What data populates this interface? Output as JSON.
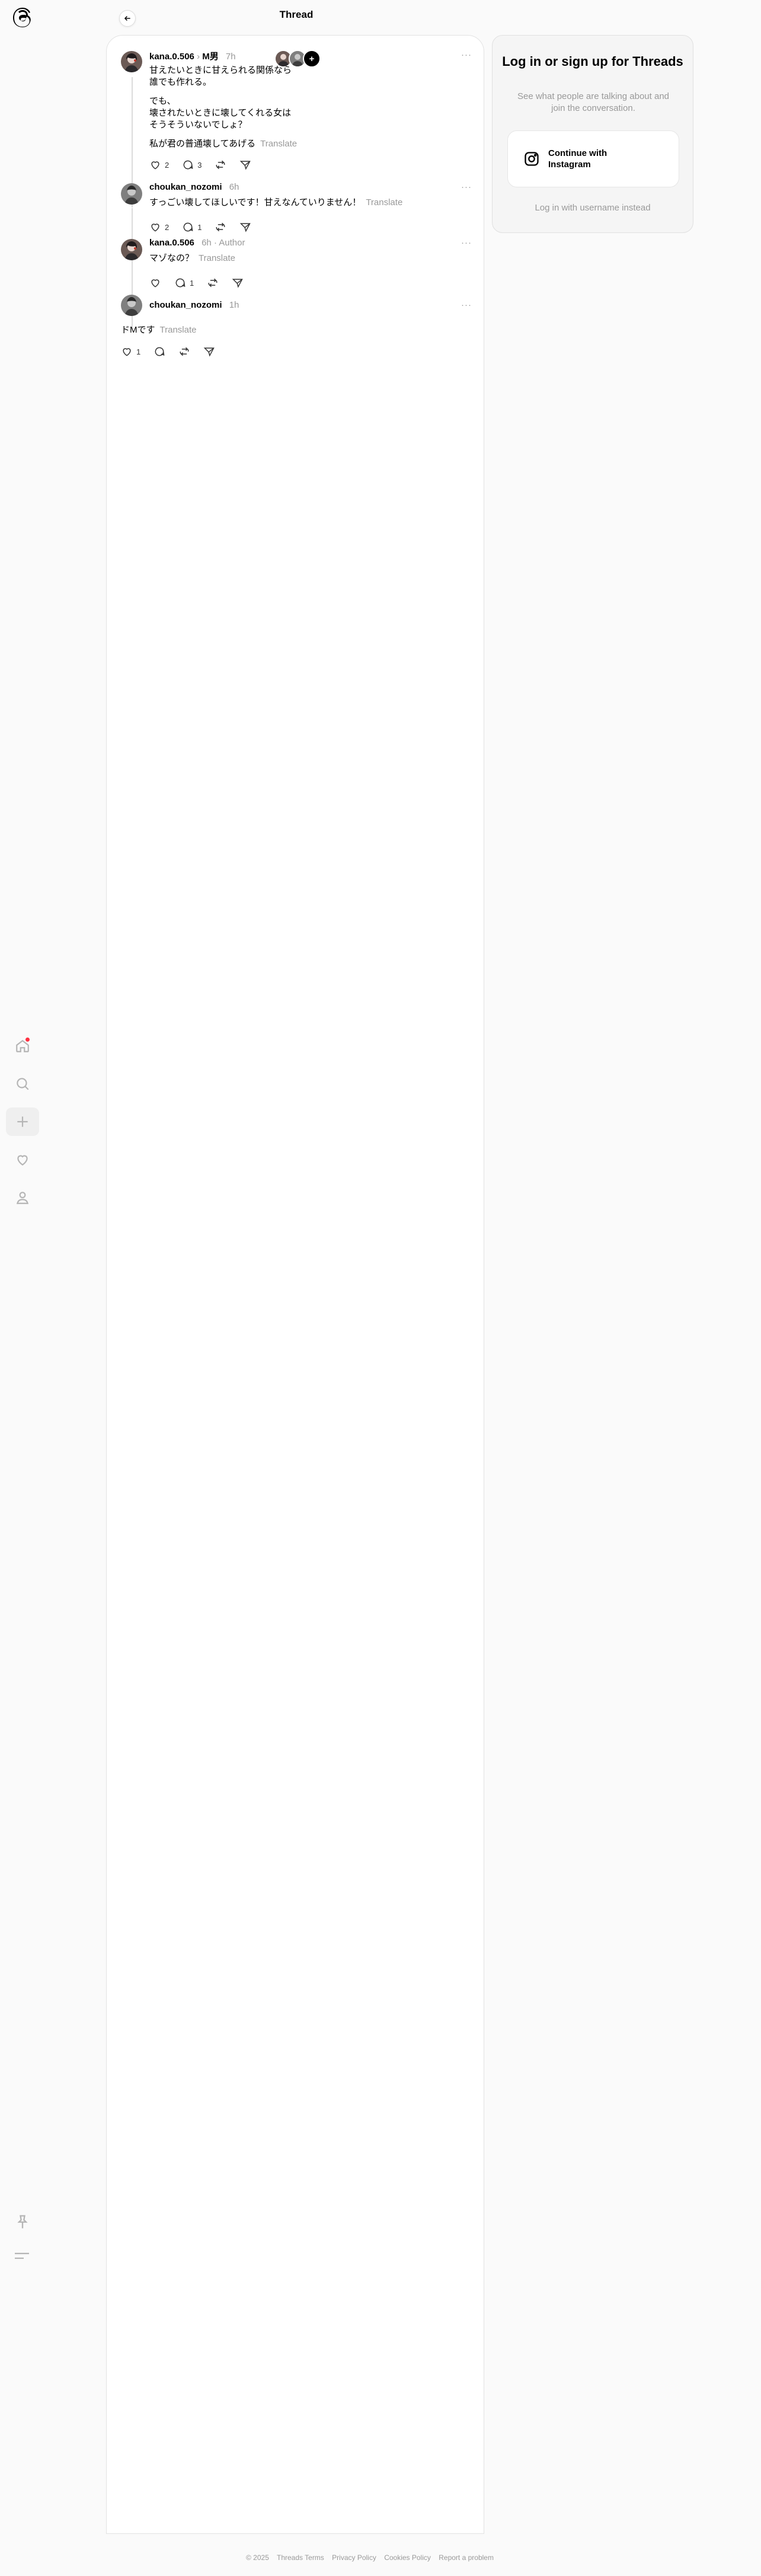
{
  "header": {
    "title": "Thread"
  },
  "nav": {
    "items": [
      "home",
      "search",
      "create",
      "activity",
      "profile"
    ]
  },
  "stack": {
    "plus": "+"
  },
  "posts": [
    {
      "username": "kana.0.506",
      "tag": "M男",
      "time": "7h",
      "lines": [
        "甘えたいときに甘えられる関係なら",
        "誰でも作れる。",
        "",
        "でも、",
        "壊されたいときに壊してくれる女は",
        "そうそういないでしょ？",
        "",
        "私が君の普通壊してあげる"
      ],
      "translate": "Translate",
      "likes": "2",
      "replies": "3"
    },
    {
      "username": "choukan_nozomi",
      "time": "6h",
      "text": "すっごい壊してほしいです！甘えなんていりません！",
      "translate": "Translate",
      "likes": "2",
      "replies": "1"
    },
    {
      "username": "kana.0.506",
      "time": "6h",
      "author": "Author",
      "text": "マゾなの？",
      "translate": "Translate",
      "replies": "1"
    },
    {
      "username": "choukan_nozomi",
      "time": "1h",
      "text": "ドMです",
      "translate": "Translate",
      "likes": "1"
    }
  ],
  "login": {
    "title": "Log in or sign up for Threads",
    "subtitle": "See what people are talking about and join the conversation.",
    "instagram_button": "Continue with Instagram",
    "alt": "Log in with username instead"
  },
  "footer": [
    "© 2025",
    "Threads Terms",
    "Privacy Policy",
    "Cookies Policy",
    "Report a problem"
  ],
  "colors": {
    "notification": "#ff3040",
    "text_muted": "#999999",
    "card_border": "#e2e2e2"
  }
}
